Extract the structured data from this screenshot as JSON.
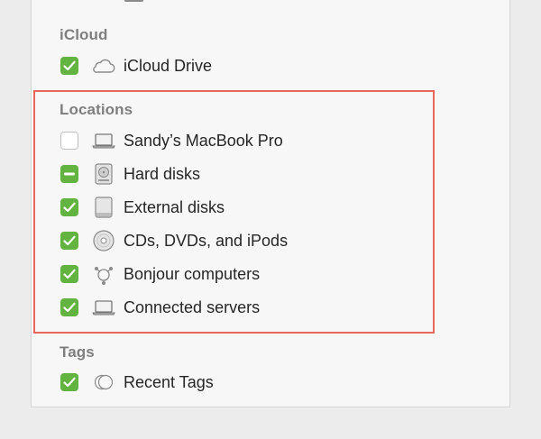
{
  "sections": {
    "icloud": {
      "title": "iCloud",
      "items": [
        {
          "label": "iCloud Drive",
          "state": "checked",
          "icon": "cloud-icon"
        }
      ]
    },
    "locations": {
      "title": "Locations",
      "items": [
        {
          "label": "Sandy’s MacBook Pro",
          "state": "unchecked",
          "icon": "laptop-icon"
        },
        {
          "label": "Hard disks",
          "state": "mixed",
          "icon": "hard-disk-icon"
        },
        {
          "label": "External disks",
          "state": "checked",
          "icon": "external-disk-icon"
        },
        {
          "label": "CDs, DVDs, and iPods",
          "state": "checked",
          "icon": "disc-icon"
        },
        {
          "label": "Bonjour computers",
          "state": "checked",
          "icon": "bonjour-icon"
        },
        {
          "label": "Connected servers",
          "state": "checked",
          "icon": "server-laptop-icon"
        }
      ]
    },
    "tags": {
      "title": "Tags",
      "items": [
        {
          "label": "Recent Tags",
          "state": "checked",
          "icon": "tags-icon"
        }
      ]
    }
  },
  "colors": {
    "checkbox_checked": "#62b33f",
    "highlight_border": "#e8665a",
    "section_title": "#7f7f7f"
  }
}
